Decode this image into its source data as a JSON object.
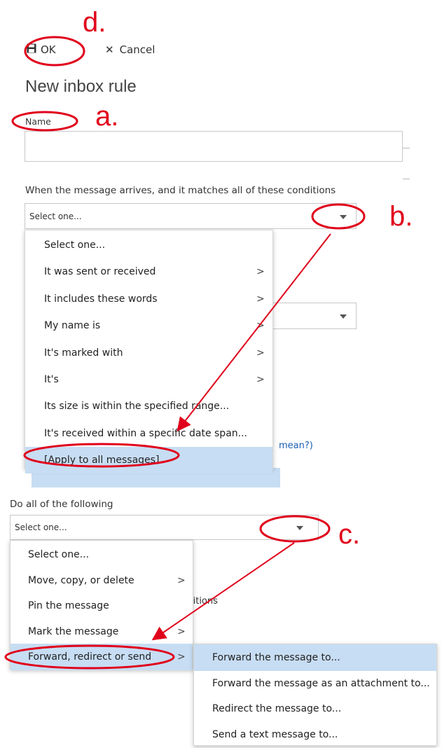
{
  "annotations": {
    "a": "a.",
    "b": "b.",
    "c": "c.",
    "d": "d."
  },
  "toolbar": {
    "ok_label": "OK",
    "cancel_label": "Cancel"
  },
  "page": {
    "title": "New inbox rule"
  },
  "form": {
    "name_label": "Name",
    "name_value": "",
    "conditions_label": "When the message arrives, and it matches all of these conditions",
    "conditions_select_value": "Select one...",
    "actions_label": "Do all of the following",
    "actions_select_value": "Select one..."
  },
  "conditions_menu": {
    "items": [
      {
        "label": "Select one...",
        "submenu": false
      },
      {
        "label": "It was sent or received",
        "submenu": true
      },
      {
        "label": "It includes these words",
        "submenu": true
      },
      {
        "label": "My name is",
        "submenu": true
      },
      {
        "label": "It's marked with",
        "submenu": true
      },
      {
        "label": "It's",
        "submenu": true
      },
      {
        "label": "Its size is within the specified range...",
        "submenu": false
      },
      {
        "label": "It's received within a specific date span...",
        "submenu": false
      },
      {
        "label": "[Apply to all messages]",
        "submenu": false,
        "highlighted": true
      }
    ]
  },
  "actions_menu": {
    "items": [
      {
        "label": "Select one...",
        "submenu": false
      },
      {
        "label": "Move, copy, or delete",
        "submenu": true
      },
      {
        "label": "Pin the message",
        "submenu": false
      },
      {
        "label": "Mark the message",
        "submenu": true
      },
      {
        "label": "Forward, redirect or send",
        "submenu": true,
        "highlighted": true
      }
    ]
  },
  "forward_submenu": {
    "items": [
      {
        "label": "Forward the message to...",
        "highlighted": true
      },
      {
        "label": "Forward the message as an attachment to..."
      },
      {
        "label": "Redirect the message to..."
      },
      {
        "label": "Send a text message to..."
      }
    ]
  },
  "background_fragments": {
    "mean": "mean?)",
    "conditions_fragment": "litions"
  },
  "colors": {
    "annotation_red": "#e0001b",
    "highlight": "#c7ddf3",
    "link_blue": "#1a5fb4"
  }
}
